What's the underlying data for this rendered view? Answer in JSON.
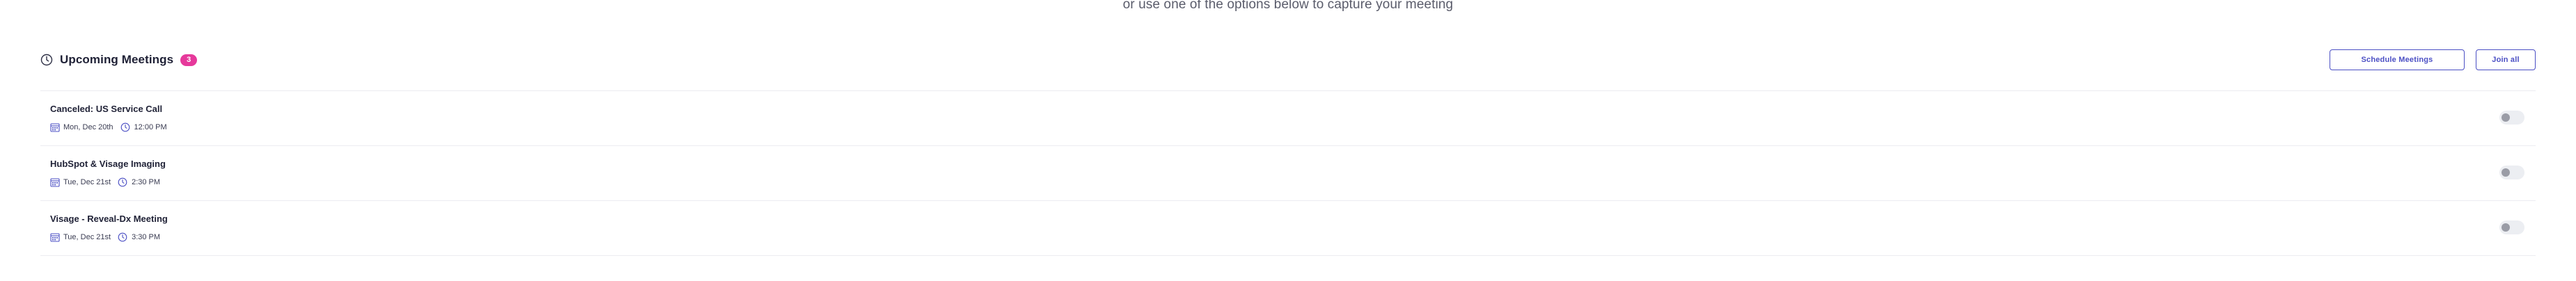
{
  "subtitle": "or use one of the options below to capture your meeting",
  "upcoming": {
    "title": "Upcoming Meetings",
    "count": "3",
    "schedule_label": "Schedule Meetings",
    "join_all_label": "Join all"
  },
  "meetings": [
    {
      "title": "Canceled: US Service Call",
      "date": "Mon, Dec 20th",
      "time": "12:00 PM",
      "toggle_on": false
    },
    {
      "title": "HubSpot & Visage Imaging",
      "date": "Tue, Dec 21st",
      "time": "2:30 PM",
      "toggle_on": false
    },
    {
      "title": "Visage - Reveal-Dx Meeting",
      "date": "Tue, Dec 21st",
      "time": "3:30 PM",
      "toggle_on": false
    }
  ],
  "colors": {
    "accent": "#4b4fc4",
    "badge": "#e6399b",
    "toggle_off": "#eceef2"
  },
  "icons": {
    "header": "clock-icon",
    "date": "calendar-icon",
    "time": "clock-icon"
  }
}
